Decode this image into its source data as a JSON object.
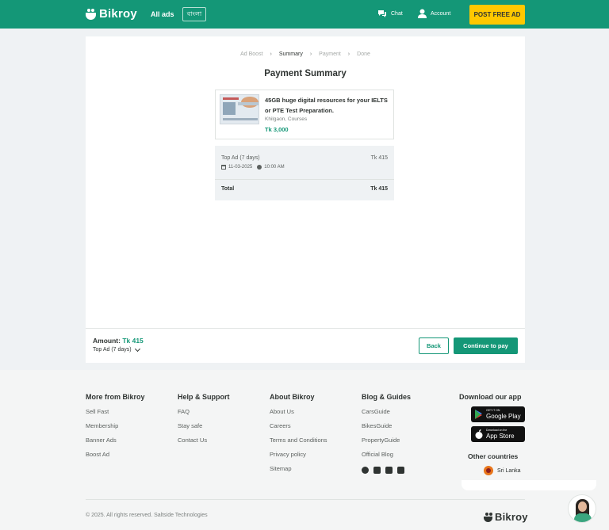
{
  "header": {
    "brand": "Bikroy",
    "all_ads": "All ads",
    "lang": "বাংলা",
    "chat": "Chat",
    "account": "Account",
    "post_ad": "POST FREE AD"
  },
  "breadcrumb": [
    "Ad Boost",
    "Summary",
    "Payment",
    "Done"
  ],
  "page": {
    "title": "Payment Summary",
    "ad": {
      "title": "45GB huge digital resources for your IELTS or PTE Test Preparation.",
      "location": "Khilgaon, Courses",
      "price": "Tk 3,000"
    },
    "summary": {
      "item": "Top Ad (7 days)",
      "item_price": "Tk 415",
      "date": "11-03-2025",
      "time": "10:00 AM",
      "total_label": "Total",
      "total_value": "Tk 415"
    },
    "amount_label": "Amount:",
    "amount_value": "Tk 415",
    "amount_sub": "Top Ad (7 days)",
    "back": "Back",
    "continue": "Continue to pay"
  },
  "footer": {
    "col1": {
      "title": "More from Bikroy",
      "links": [
        "Sell Fast",
        "Membership",
        "Banner Ads",
        "Boost Ad"
      ]
    },
    "col2": {
      "title": "Help & Support",
      "links": [
        "FAQ",
        "Stay safe",
        "Contact Us"
      ]
    },
    "col3": {
      "title": "About Bikroy",
      "links": [
        "About Us",
        "Careers",
        "Terms and Conditions",
        "Privacy policy",
        "Sitemap"
      ]
    },
    "col4": {
      "title": "Blog & Guides",
      "links": [
        "CarsGuide",
        "BikesGuide",
        "PropertyGuide",
        "Official Blog"
      ]
    },
    "app": {
      "title": "Download our app",
      "google_small": "GET IT ON",
      "google_big": "Google Play",
      "apple_small": "Download on the",
      "apple_big": "App Store"
    },
    "other_countries": "Other countries",
    "country": "Sri Lanka",
    "copyright": "© 2025. All rights reserved. Saltside Technologies",
    "brand": "Bikroy"
  }
}
